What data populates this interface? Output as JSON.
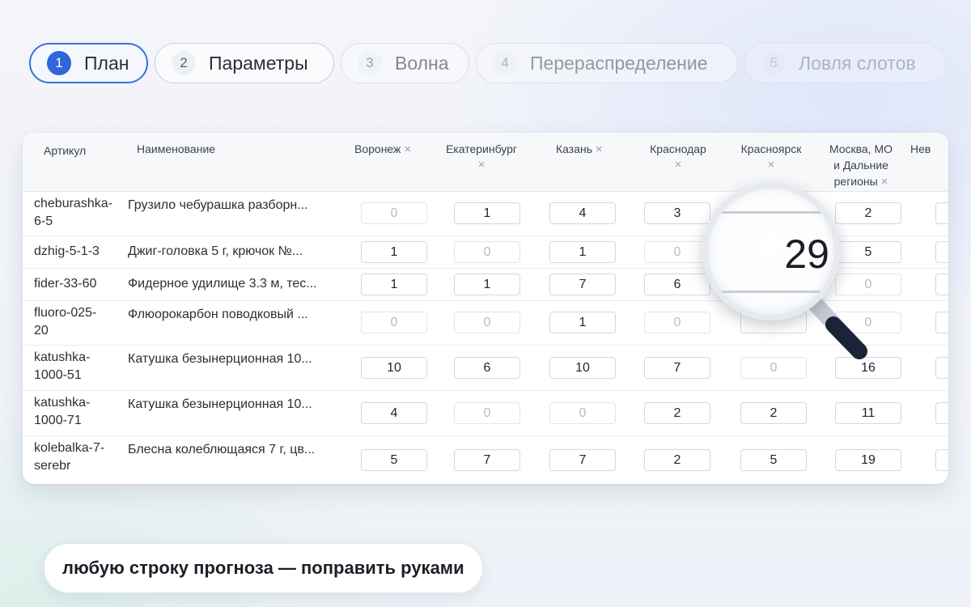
{
  "stepper": [
    {
      "num": "1",
      "label": "План"
    },
    {
      "num": "2",
      "label": "Параметры"
    },
    {
      "num": "3",
      "label": "Волна"
    },
    {
      "num": "4",
      "label": "Перераспределение"
    },
    {
      "num": "5",
      "label": "Ловля слотов"
    }
  ],
  "table": {
    "headers": {
      "sku": "Артикул",
      "name": "Наименование",
      "voronezh": "Воронеж",
      "ekb": "Екатеринбург",
      "kazan": "Казань",
      "krasnodar": "Краснодар",
      "krasnoyarsk": "Красноярск",
      "moscow_l1": "Москва, МО",
      "moscow_l2": "и Дальние",
      "moscow_l3": "регионы",
      "next": "Нев",
      "remove_icon": "×"
    },
    "rows": [
      {
        "sku": "cheburashka-\n6-5",
        "name": "Грузило чебурашка разборн...",
        "v": [
          "0",
          "1",
          "4",
          "3",
          "",
          "2"
        ]
      },
      {
        "sku": "dzhig-5-1-3",
        "name": "Джиг-головка 5 г, крючок №...",
        "v": [
          "1",
          "0",
          "1",
          "0",
          "",
          "5"
        ]
      },
      {
        "sku": "fider-33-60",
        "name": "Фидерное удилище 3.3 м, тес...",
        "v": [
          "1",
          "1",
          "7",
          "6",
          "",
          "0"
        ]
      },
      {
        "sku": "fluoro-025-\n20",
        "name": "Флюорокарбон поводковый ...",
        "v": [
          "0",
          "0",
          "1",
          "0",
          "",
          "0"
        ]
      },
      {
        "sku": "katushka-\n1000-51",
        "name": "Катушка безынерционная 10...",
        "v": [
          "10",
          "6",
          "10",
          "7",
          "0",
          "16"
        ]
      },
      {
        "sku": "katushka-\n1000-71",
        "name": "Катушка безынерционная 10...",
        "v": [
          "4",
          "0",
          "0",
          "2",
          "2",
          "11"
        ]
      },
      {
        "sku": "kolebalka-7-\nserebr",
        "name": "Блесна колеблющаяся 7 г, цв...",
        "v": [
          "5",
          "7",
          "7",
          "2",
          "5",
          "19"
        ]
      }
    ]
  },
  "magnifier": {
    "value": "29",
    "icon": "magnifier-icon"
  },
  "caption": "любую строку прогноза — поправить руками",
  "colors": {
    "accent": "#2f66d8",
    "zero_text": "#b7bcc5"
  }
}
